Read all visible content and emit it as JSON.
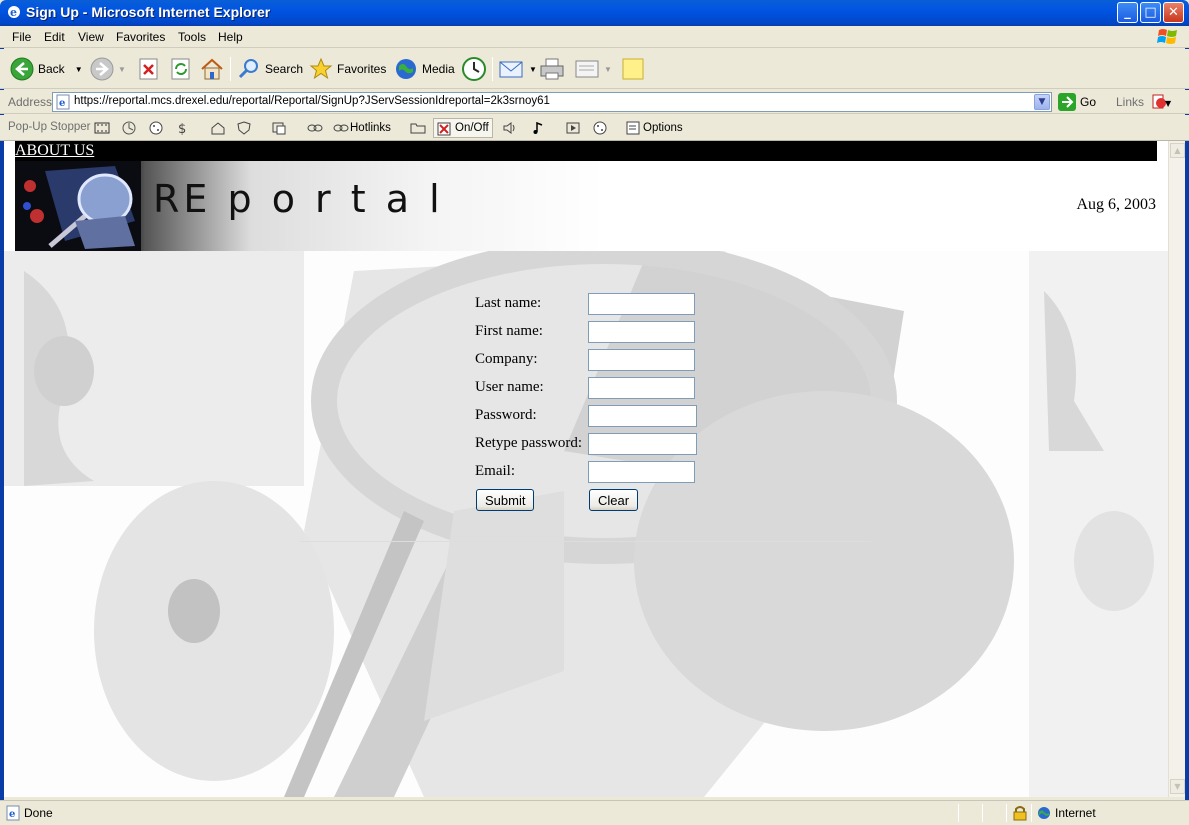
{
  "window": {
    "title": "Sign Up - Microsoft Internet Explorer",
    "minimize": "_",
    "maximize": "□",
    "close": "✕"
  },
  "menu": [
    "File",
    "Edit",
    "View",
    "Favorites",
    "Tools",
    "Help"
  ],
  "toolbar": {
    "back_label": "Back",
    "search_label": "Search",
    "favorites_label": "Favorites",
    "media_label": "Media"
  },
  "address": {
    "label": "Address",
    "url": "https://reportal.mcs.drexel.edu/reportal/Reportal/SignUp?JServSessionIdreportal=2k3srnoy61",
    "go_label": "Go",
    "links_label": "Links"
  },
  "popup_stopper": {
    "label": "Pop-Up Stopper",
    "hotlinks_label": "Hotlinks",
    "onoff_label": "On/Off",
    "options_label": "Options"
  },
  "page": {
    "about_link": "ABOUT US",
    "banner_title": "REportal",
    "banner_title_display": "RE p o r t a l",
    "date": "Aug 6, 2003",
    "form": {
      "fields": [
        {
          "label": "Last name:",
          "value": ""
        },
        {
          "label": "First name:",
          "value": ""
        },
        {
          "label": "Company:",
          "value": ""
        },
        {
          "label": "User name:",
          "value": ""
        },
        {
          "label": "Password:",
          "value": ""
        },
        {
          "label": "Retype password:",
          "value": ""
        },
        {
          "label": "Email:",
          "value": ""
        }
      ],
      "submit_label": "Submit",
      "clear_label": "Clear"
    }
  },
  "status": {
    "text": "Done",
    "zone": "Internet"
  },
  "colors": {
    "titlebar": "#0054E3",
    "chrome": "#ECE9D8",
    "top_strip": "#000000"
  }
}
